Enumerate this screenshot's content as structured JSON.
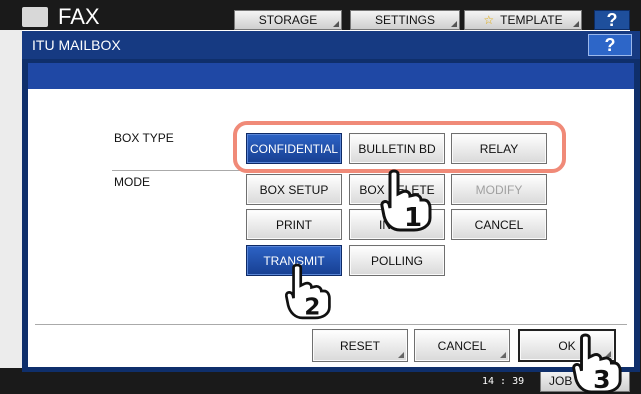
{
  "background": {
    "app_title": "FAX",
    "tabs": [
      {
        "label": "STORAGE"
      },
      {
        "label": "SETTINGS"
      },
      {
        "label": "TEMPLATE"
      }
    ],
    "help_label": "?",
    "clock": "14 : 39",
    "job_button_label": "JOB STATUS"
  },
  "dialog": {
    "title": "ITU MAILBOX",
    "help_label": "?",
    "box_type_label": "BOX TYPE",
    "mode_label": "MODE",
    "box_type_buttons": [
      {
        "label": "CONFIDENTIAL",
        "state": "selected"
      },
      {
        "label": "BULLETIN BD",
        "state": "normal"
      },
      {
        "label": "RELAY",
        "state": "normal"
      }
    ],
    "mode_buttons": [
      {
        "label": "BOX SETUP",
        "state": "normal"
      },
      {
        "label": "BOX DELETE",
        "state": "normal"
      },
      {
        "label": "MODIFY",
        "state": "disabled"
      },
      {
        "label": "PRINT",
        "state": "normal"
      },
      {
        "label": "INPUT",
        "state": "normal"
      },
      {
        "label": "CANCEL",
        "state": "normal"
      },
      {
        "label": "TRANSMIT",
        "state": "selected"
      },
      {
        "label": "POLLING",
        "state": "normal"
      }
    ],
    "footer_buttons": [
      {
        "label": "RESET"
      },
      {
        "label": "CANCEL"
      },
      {
        "label": "OK"
      }
    ]
  },
  "annotations": [
    {
      "step": "1"
    },
    {
      "step": "2"
    },
    {
      "step": "3"
    }
  ],
  "colors": {
    "selected_button": "#1f4fa8",
    "highlight_ring": "#f08a78",
    "dialog_frame": "#0f2f6b"
  }
}
